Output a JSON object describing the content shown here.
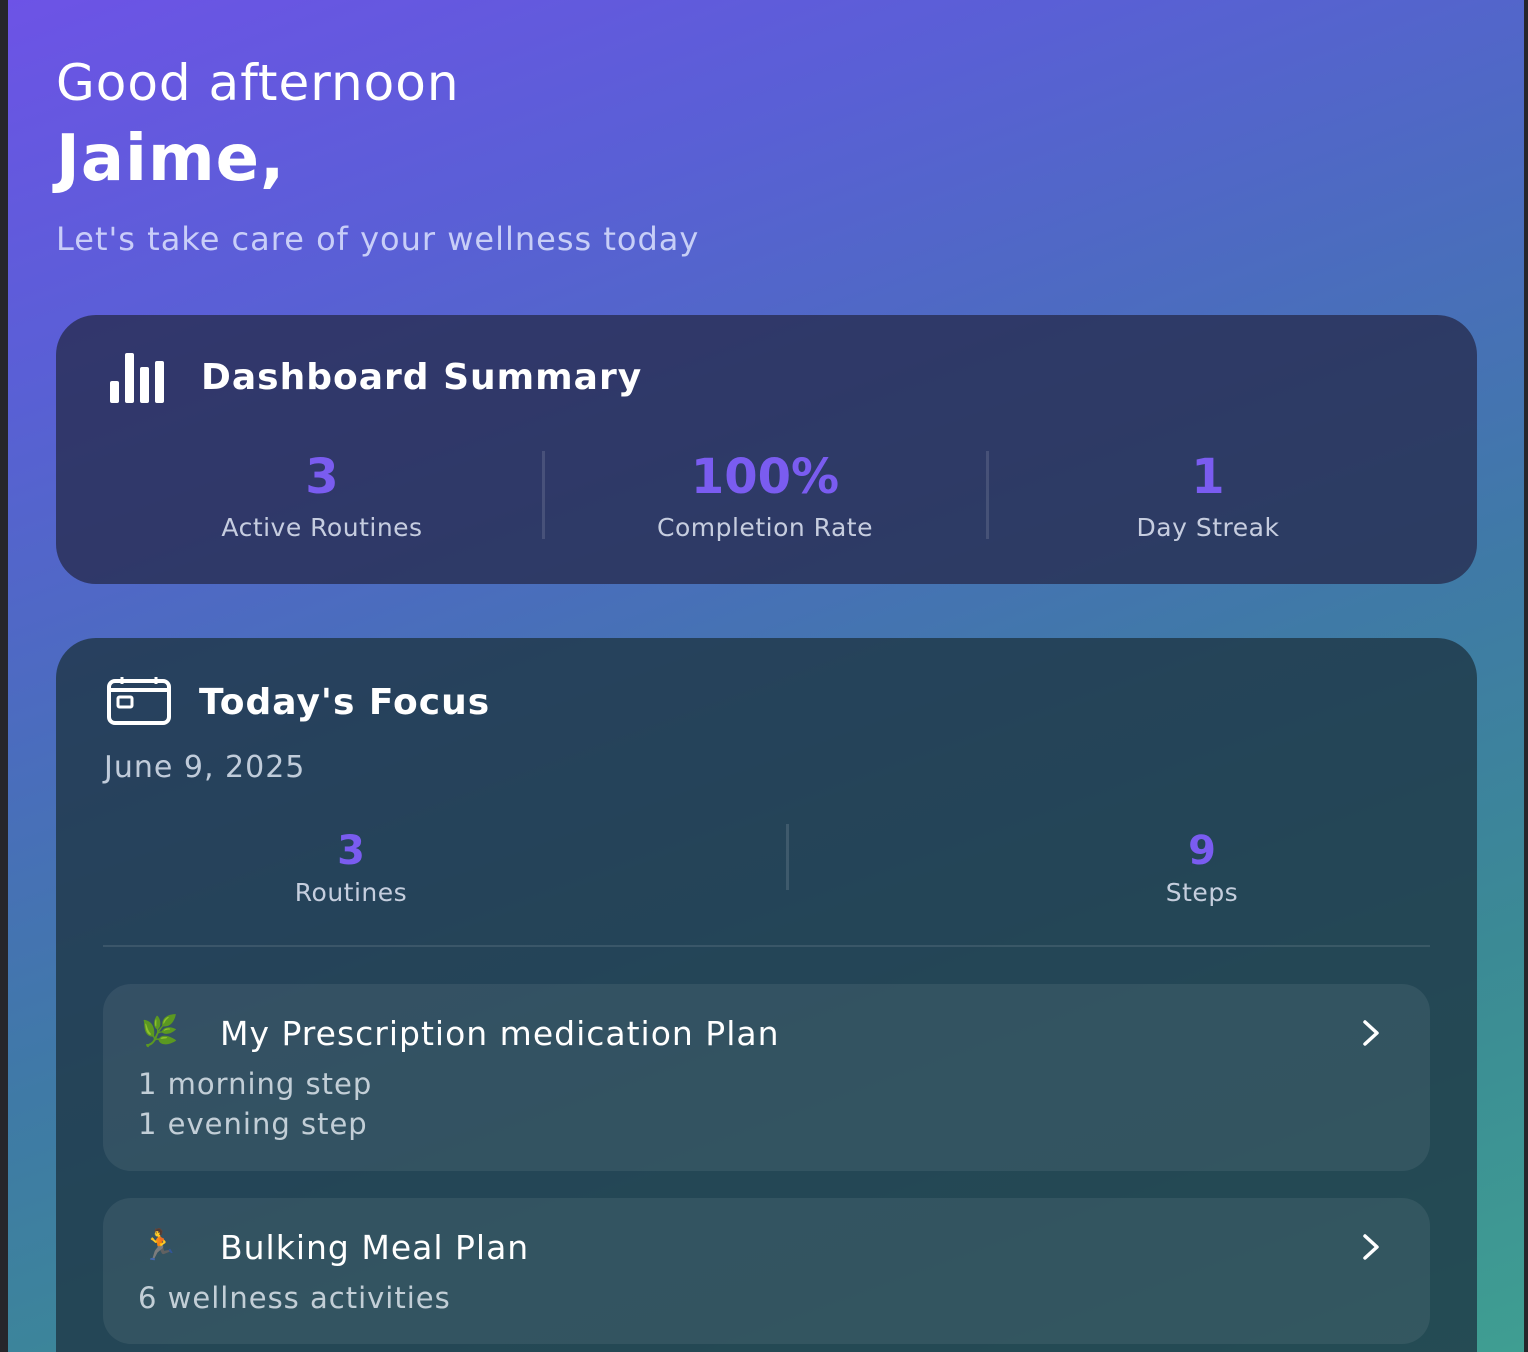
{
  "header": {
    "greeting": "Good afternoon",
    "name": "Jaime,",
    "tagline": "Let's take care of your wellness today"
  },
  "summary": {
    "title": "Dashboard Summary",
    "icon": "bar-chart-icon",
    "stats": [
      {
        "value": "3",
        "label": "Active Routines"
      },
      {
        "value": "100%",
        "label": "Completion Rate"
      },
      {
        "value": "1",
        "label": "Day Streak"
      }
    ]
  },
  "focus": {
    "title": "Today's Focus",
    "icon": "calendar-icon",
    "date": "June 9, 2025",
    "stats": [
      {
        "value": "3",
        "label": "Routines"
      },
      {
        "value": "9",
        "label": "Steps"
      }
    ],
    "routines": [
      {
        "emoji": "🌿",
        "icon": "herb-icon",
        "title": "My Prescription medication Plan",
        "lines": [
          "1 morning step",
          "1 evening step"
        ]
      },
      {
        "emoji": "🏃",
        "icon": "runner-icon",
        "title": "Bulking Meal Plan",
        "lines": [
          "6 wellness activities"
        ]
      }
    ]
  },
  "colors": {
    "accent": "#7a5cf0",
    "gradient_top": "#6d53e6",
    "gradient_bottom": "#3f9e92"
  }
}
